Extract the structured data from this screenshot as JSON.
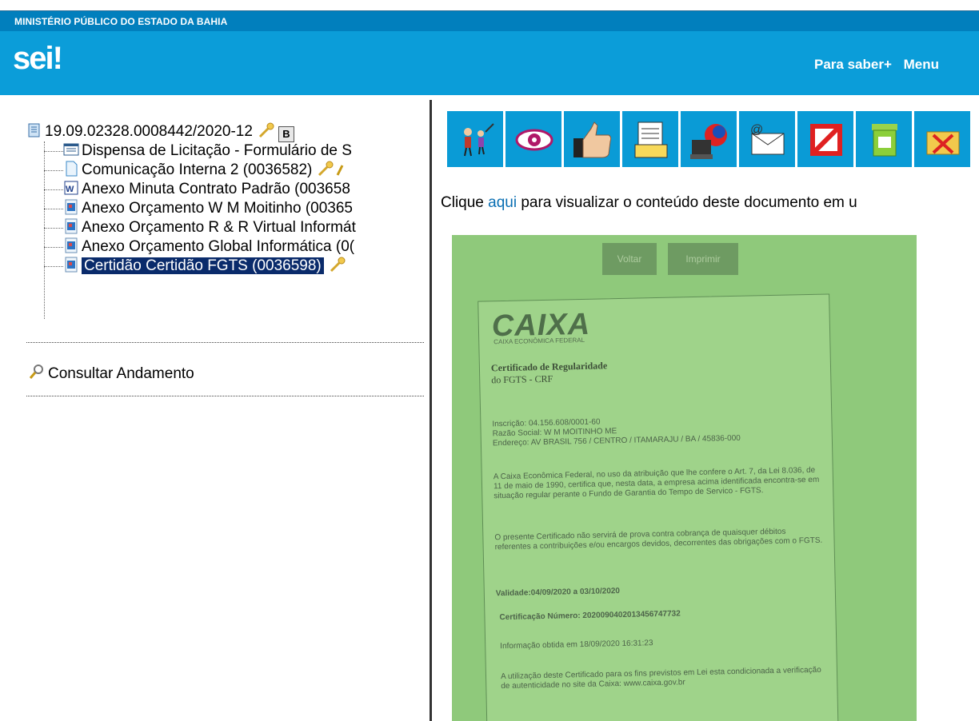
{
  "header": {
    "org": "MINISTÉRIO PÚBLICO DO ESTADO DA BAHIA",
    "logo_main": "sei",
    "logo_bang": "!",
    "nav": [
      "Para saber+",
      "Menu"
    ]
  },
  "tree": {
    "process": "19.09.02328.0008442/2020-12",
    "process_badge": "B",
    "items": [
      {
        "label": "Dispensa de Licitação - Formulário de S"
      },
      {
        "label": "Comunicação Interna 2 (0036582)"
      },
      {
        "label": "Anexo Minuta Contrato Padrão (003658"
      },
      {
        "label": "Anexo Orçamento W M Moitinho (00365"
      },
      {
        "label": "Anexo Orçamento R & R Virtual Informát"
      },
      {
        "label": "Anexo Orçamento Global Informática (0("
      },
      {
        "label": "Certidão Certidão FGTS (0036598)"
      }
    ],
    "consultar": "Consultar Andamento"
  },
  "toolbar": {
    "buttons": [
      "users-icon",
      "eye-icon",
      "thumbs-up-icon",
      "document-sign-icon",
      "computer-globe-icon",
      "email-icon",
      "cancel-icon",
      "recycle-bin-icon",
      "folder-remove-icon"
    ]
  },
  "content": {
    "clique_prefix": "Clique ",
    "clique_link": "aqui",
    "clique_suffix": " para visualizar o conteúdo deste documento em u"
  },
  "document": {
    "btn_voltar": "Voltar",
    "btn_imprimir": "Imprimir",
    "logo": "CAIXA",
    "logo_sub": "CAIXA ECONÔMICA FEDERAL",
    "title1": "Certificado de Regularidade",
    "title2": "do FGTS - CRF",
    "inscricao": "Inscrição:   04.156.608/0001-60",
    "razao": "Razão Social: W M MOITINHO ME",
    "endereco": "Endereço:    AV BRASIL 756 / CENTRO / ITAMARAJU / BA / 45836-000",
    "p1": "A Caixa Econômica Federal, no uso da atribuição que lhe confere o Art. 7, da Lei 8.036, de 11 de maio de 1990, certifica que, nesta data, a empresa acima identificada encontra-se em situação regular perante o Fundo de Garantia do Tempo de Servico - FGTS.",
    "p2": "O presente Certificado não servirá de prova contra cobrança de quaisquer débitos referentes a contribuições e/ou encargos devidos, decorrentes das obrigações com o FGTS.",
    "validade": "Validade:04/09/2020 a 03/10/2020",
    "certnum": "Certificação Número: 2020090402013456747732",
    "info": "Informação obtida em 18/09/2020 16:31:23",
    "p3": "A utilização deste Certificado para os fins previstos em Lei esta condicionada a verificação de autenticidade no site da Caixa: www.caixa.gov.br"
  }
}
